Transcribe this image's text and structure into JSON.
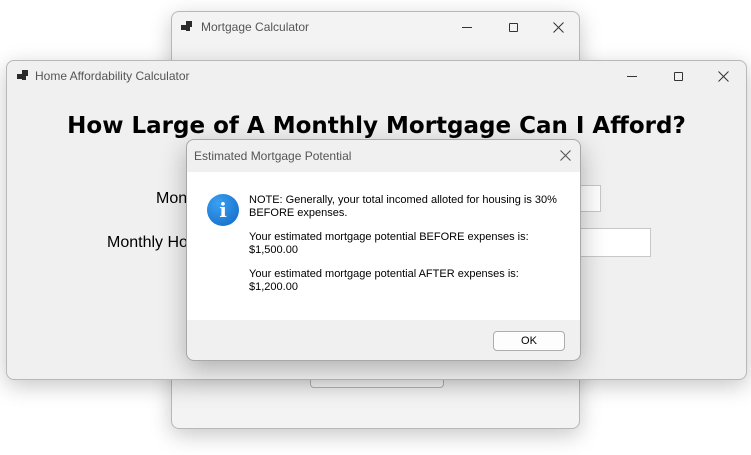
{
  "back_window": {
    "title": "Mortgage Calculator"
  },
  "main_window": {
    "title": "Home Affordability Calculator",
    "heading": "How Large of A Monthly Mortgage Can I Afford?",
    "fields": [
      {
        "label": "Mon",
        "value": ""
      },
      {
        "label": "Monthly Ho",
        "value": ""
      }
    ]
  },
  "dialog": {
    "title": "Estimated Mortgage Potential",
    "icon": "info-icon",
    "messages": [
      "NOTE: Generally, your total incomed alloted for housing is 30% BEFORE expenses.",
      "Your estimated mortgage potential BEFORE expenses is: $1,500.00",
      "Your estimated mortgage potential AFTER expenses is: $1,200.00"
    ],
    "ok_label": "OK"
  }
}
